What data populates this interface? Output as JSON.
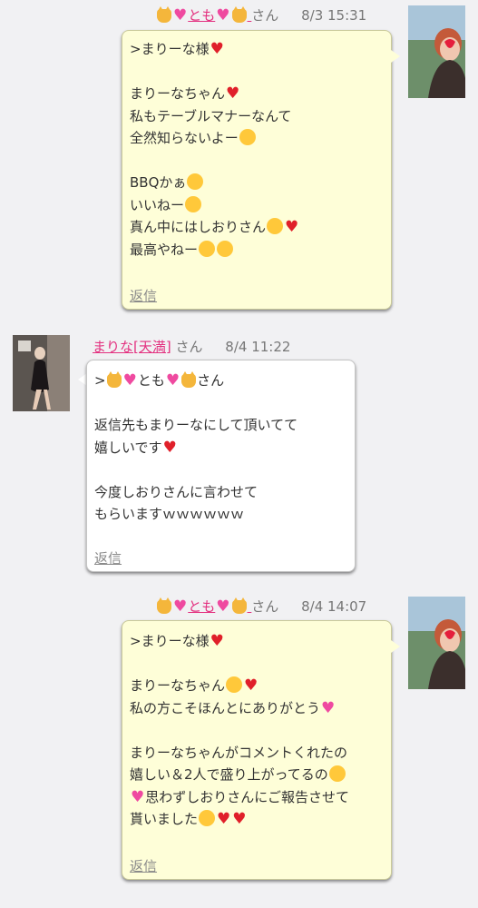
{
  "messages": [
    {
      "sender_parts": [
        "🐱",
        "💓",
        "とも",
        "💓",
        "🐱"
      ],
      "sender_name": "とも",
      "honorific": "さん",
      "timestamp": "8/3 15:31",
      "lines": [
        ">まりーな様❤️",
        "",
        "まりーなちゃん❤️",
        "私もテーブルマナーなんて",
        "全然知らないよー🤣",
        "",
        "BBQかぁ☺",
        "いいねー😙",
        "真ん中にはしおりさん😍❤️",
        "最高やねー😍😍"
      ],
      "reply_label": "返信"
    },
    {
      "sender_name": "まりな[天満]",
      "honorific": "さん",
      "timestamp": "8/4 11:22",
      "lines": [
        ">🐱💓とも💓🐱さん",
        "",
        "返信先もまりーなにして頂いてて",
        "嬉しいです❤️",
        "",
        "今度しおりさんに言わせて",
        "もらいますｗｗｗｗｗｗ"
      ],
      "reply_label": "返信"
    },
    {
      "sender_name": "とも",
      "honorific": "さん",
      "timestamp": "8/4 14:07",
      "lines": [
        ">まりーな様❤️",
        "",
        "まりーなちゃん☺️❤️",
        "私の方こそほんとにありがとう💓",
        "",
        "まりーなちゃんがコメントくれたの",
        "嬉しい＆2人で盛り上がってるの😆",
        "💓思わずしおりさんにご報告させて",
        "貰いました😆❤️❤️"
      ],
      "reply_label": "返信"
    }
  ]
}
